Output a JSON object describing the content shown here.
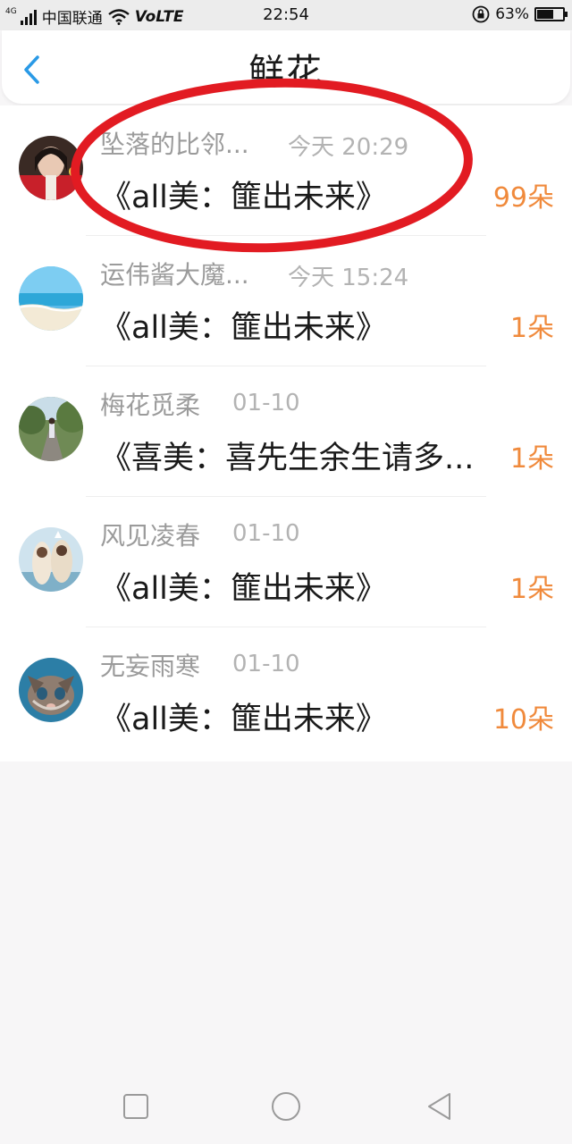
{
  "status_bar": {
    "network": "4G",
    "carrier": "中国联通",
    "volte": "VoLTE",
    "time": "22:54",
    "battery_percent": "63%",
    "battery_level": 0.63
  },
  "header": {
    "title": "鲜花",
    "back_icon": "chevron-left-icon",
    "accent_color": "#2a9ae6"
  },
  "list": {
    "items": [
      {
        "name": "坠落的比邻...",
        "time": "今天 20:29",
        "book": "《all美：篚出未来》",
        "count": "99朵"
      },
      {
        "name": "运伟酱大魔...",
        "time": "今天 15:24",
        "book": "《all美：篚出未来》",
        "count": "1朵"
      },
      {
        "name": "梅花觅柔",
        "time": "01-10",
        "book": "《喜美：喜先生余生请多...",
        "count": "1朵"
      },
      {
        "name": "风见凌春",
        "time": "01-10",
        "book": "《all美：篚出未来》",
        "count": "1朵"
      },
      {
        "name": "无妄雨寒",
        "time": "01-10",
        "book": "《all美：篚出未来》",
        "count": "10朵"
      }
    ]
  },
  "colors": {
    "count": "#f08a3c",
    "annotation": "#e21b22"
  },
  "navbar": {
    "icons": [
      "square-icon",
      "circle-icon",
      "triangle-back-icon"
    ]
  }
}
